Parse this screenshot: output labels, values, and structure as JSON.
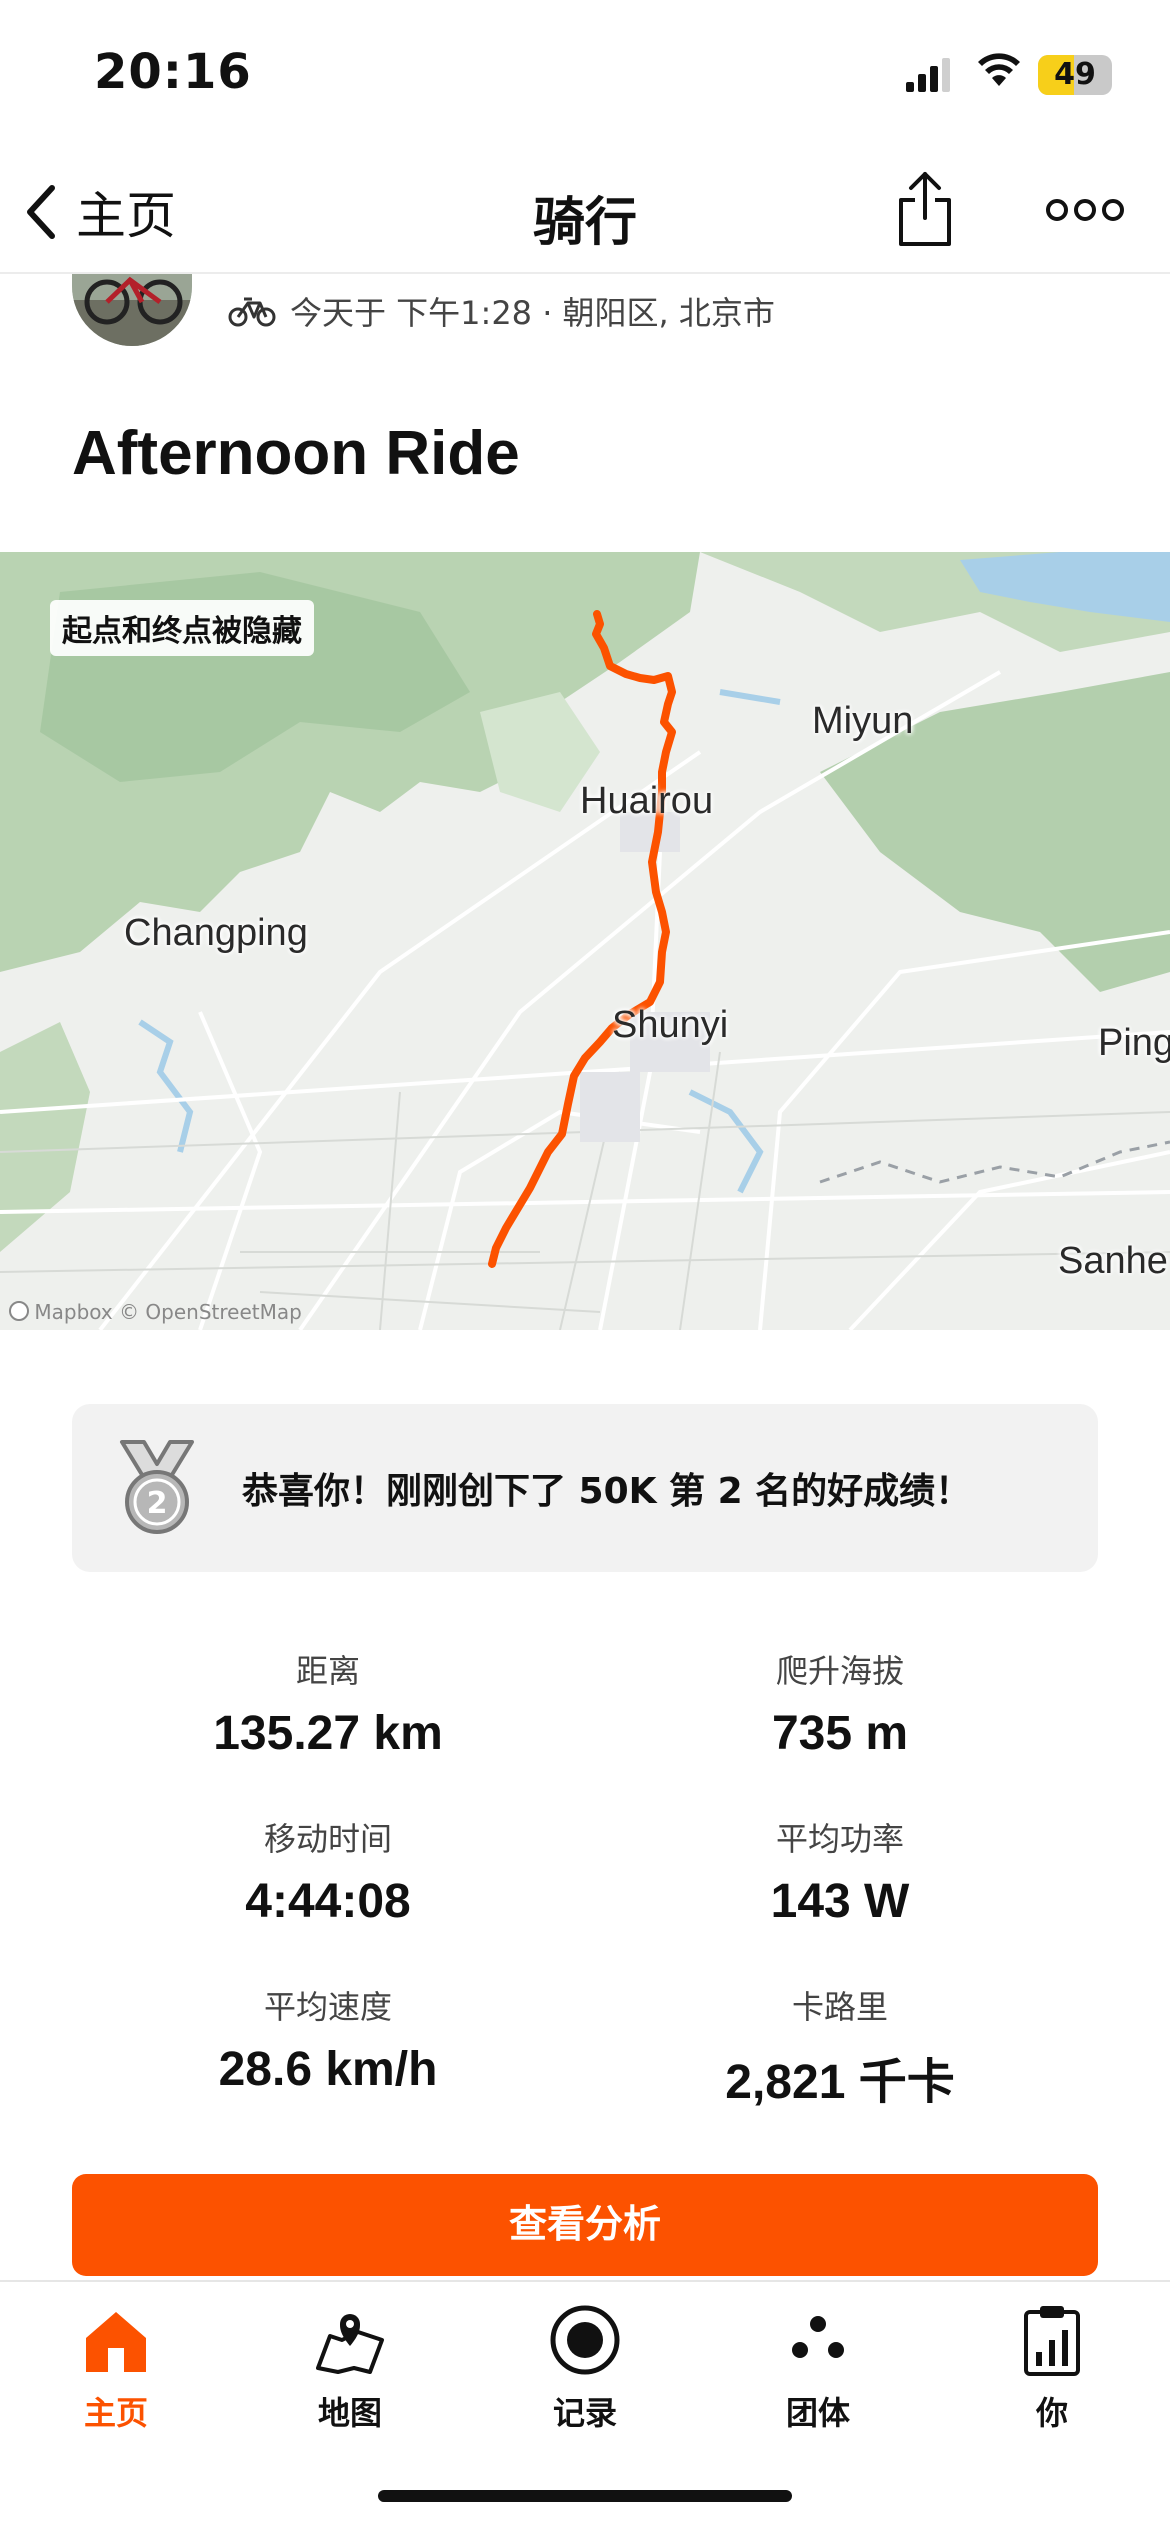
{
  "status": {
    "time": "20:16",
    "battery": "49",
    "battery_level": 0.49
  },
  "nav": {
    "back_label": "主页",
    "title": "骑行"
  },
  "activity": {
    "meta": "今天于 下午1:28 · 朝阳区, 北京市",
    "title": "Afternoon Ride"
  },
  "map": {
    "privacy_tag": "起点和终点被隐藏",
    "places": [
      "Miyun",
      "Huairou",
      "Changping",
      "Shunyi",
      "Ping",
      "Sanhe"
    ],
    "attribution": "© Mapbox © OpenStreetMap",
    "route_color": "#fc5200"
  },
  "achievement": {
    "text": "恭喜你！刚刚创下了 50K 第 2 名的好成绩！",
    "medal_rank": "2"
  },
  "stats": [
    {
      "label": "距离",
      "value": "135.27 km"
    },
    {
      "label": "爬升海拔",
      "value": "735 m"
    },
    {
      "label": "移动时间",
      "value": "4:44:08"
    },
    {
      "label": "平均功率",
      "value": "143 W"
    },
    {
      "label": "平均速度",
      "value": "28.6 km/h"
    },
    {
      "label": "卡路里",
      "value": "2,821 千卡"
    }
  ],
  "cta": {
    "label": "查看分析"
  },
  "tabs": [
    {
      "label": "主页",
      "icon": "home-icon",
      "active": true
    },
    {
      "label": "地图",
      "icon": "map-icon",
      "active": false
    },
    {
      "label": "记录",
      "icon": "record-icon",
      "active": false
    },
    {
      "label": "团体",
      "icon": "groups-icon",
      "active": false
    },
    {
      "label": "你",
      "icon": "profile-icon",
      "active": false
    }
  ],
  "colors": {
    "accent": "#fc5200",
    "battery": "#f7cf1a"
  }
}
